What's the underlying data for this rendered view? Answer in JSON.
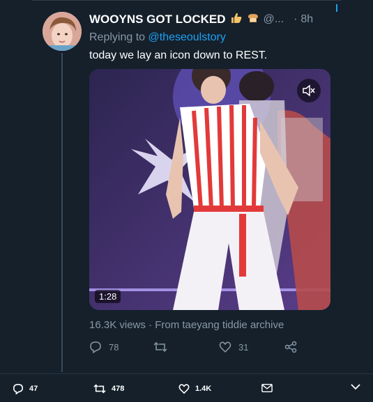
{
  "tweet": {
    "display_name": "WOOYNS GOT LOCKED",
    "name_emojis": [
      "thumbs-up-icon",
      "bread-icon"
    ],
    "handle": "@...",
    "time_separator": "·",
    "time": "8h",
    "reply_prefix": "Replying to",
    "reply_to": "@theseoulstory",
    "text": "today we lay an icon down to REST.",
    "media": {
      "duration": "1:28",
      "mute_icon": "speaker-muted-icon"
    },
    "meta": "16.3K views · From taeyang tiddie archive",
    "actions": {
      "replies": "78",
      "retweets": "",
      "likes": "31"
    }
  },
  "bottom_bar": {
    "replies": "47",
    "retweets": "478",
    "likes": "1.4K"
  },
  "colors": {
    "background": "#15202b",
    "secondary_text": "#8899a6",
    "link": "#1da1f2"
  }
}
